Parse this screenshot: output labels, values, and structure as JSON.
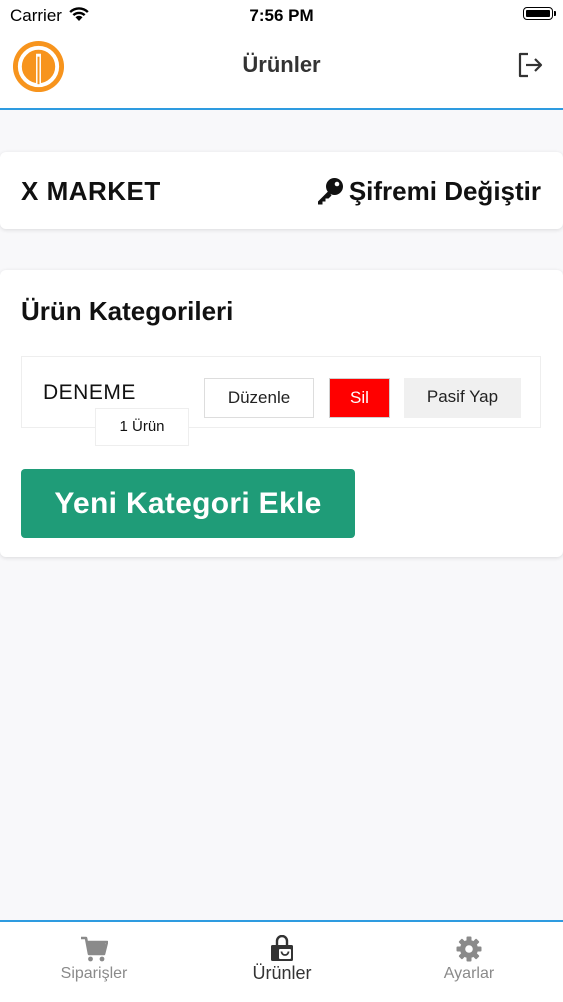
{
  "status_bar": {
    "carrier": "Carrier",
    "time": "7:56 PM"
  },
  "nav": {
    "title": "Ürünler",
    "logout_icon": "logout-icon",
    "logo_color": "#f7941d"
  },
  "store": {
    "name": "X MARKET",
    "change_password_label": "Şifremi Değiştir",
    "icon": "key-icon"
  },
  "categories": {
    "title": "Ürün Kategorileri",
    "items": [
      {
        "name": "DENEME",
        "count_label": "1 Ürün",
        "edit_label": "Düzenle",
        "delete_label": "Sil",
        "passive_label": "Pasif Yap"
      }
    ],
    "add_button_label": "Yeni Kategori Ekle"
  },
  "tabs": [
    {
      "label": "Siparişler",
      "icon": "cart-icon",
      "active": false
    },
    {
      "label": "Ürünler",
      "icon": "shopping-bag-icon",
      "active": true
    },
    {
      "label": "Ayarlar",
      "icon": "gear-icon",
      "active": false
    }
  ],
  "colors": {
    "accent": "#2e9be0",
    "add_button": "#1f9c78",
    "delete_button": "#ff0000"
  }
}
